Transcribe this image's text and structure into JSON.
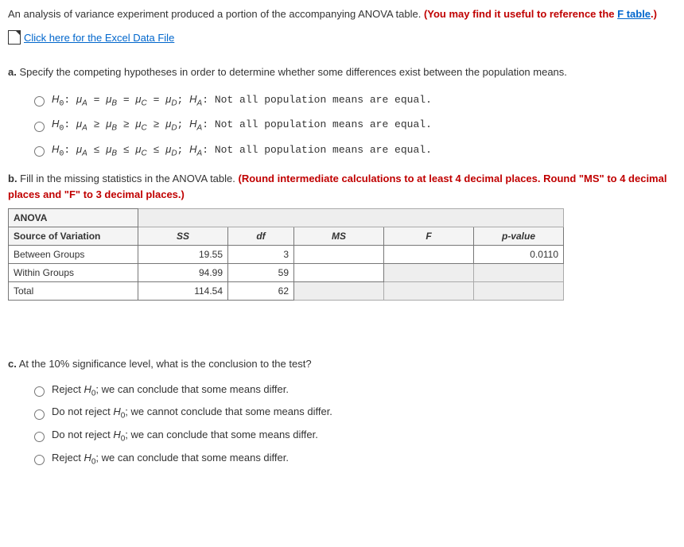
{
  "intro": {
    "text1": "An analysis of variance experiment produced a portion of the accompanying ANOVA table. ",
    "red_prefix": "(You may find it useful to reference the ",
    "f_link": "F table",
    "red_suffix": ".)"
  },
  "excel_link": "Click here for the Excel Data File",
  "part_a": {
    "label": "a.",
    "text": " Specify the competing hypotheses in order to determine whether some differences exist between the population means.",
    "options": [
      "H0: μA = μB = μC = μD; HA: Not all population means are equal.",
      "H0: μA ≥ μB ≥ μC ≥ μD; HA: Not all population means are equal.",
      "H0: μA ≤ μB ≤ μC ≤ μD; HA: Not all population means are equal."
    ]
  },
  "part_b": {
    "label": "b.",
    "text": " Fill in the missing statistics in the ANOVA table. ",
    "red": "(Round intermediate calculations to at least 4 decimal places. Round \"MS\" to 4 decimal places and \"F\" to 3 decimal places.)"
  },
  "anova": {
    "title": "ANOVA",
    "headers": [
      "Source of Variation",
      "SS",
      "df",
      "MS",
      "F",
      "p-value"
    ],
    "rows": [
      {
        "label": "Between Groups",
        "ss": "19.55",
        "df": "3",
        "ms": "",
        "f": "",
        "p": "0.0110"
      },
      {
        "label": "Within Groups",
        "ss": "94.99",
        "df": "59",
        "ms": "",
        "f": "",
        "p": ""
      },
      {
        "label": "Total",
        "ss": "114.54",
        "df": "62",
        "ms": "",
        "f": "",
        "p": ""
      }
    ]
  },
  "part_c": {
    "label": "c.",
    "text": " At the 10% significance level, what is the conclusion to the test?",
    "options": [
      "Reject H0; we can conclude that some means differ.",
      "Do not reject H0; we cannot conclude that some means differ.",
      "Do not reject H0; we can conclude that some means differ.",
      "Reject H0; we can conclude that some means differ."
    ]
  }
}
